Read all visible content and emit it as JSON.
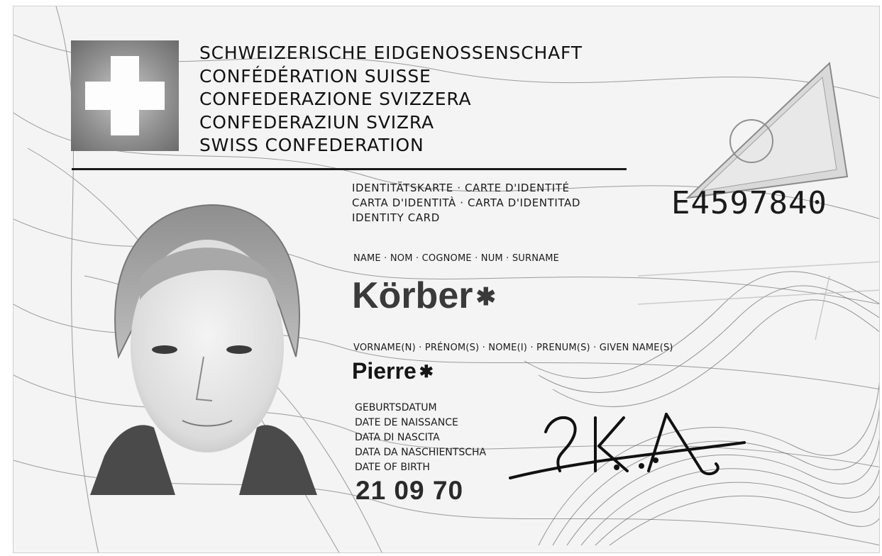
{
  "card": {
    "confederation_lines": [
      "SCHWEIZERISCHE EIDGENOSSENSCHAFT",
      "CONFÉDÉRATION SUISSE",
      "CONFEDERAZIONE SVIZZERA",
      "CONFEDERAZIUN SVIZRA",
      "SWISS CONFEDERATION"
    ],
    "document_type_lines": [
      "IDENTITÄTSKARTE · CARTE D'IDENTITÉ",
      "CARTA D'IDENTITÀ · CARTA D'IDENTITAD",
      "IDENTITY CARD"
    ],
    "document_number": "E4597840",
    "surname_label": "NAME · NOM · COGNOME · NUM · SURNAME",
    "surname": "Körber",
    "given_names_label": "VORNAME(N) · PRÉNOM(S) · NOME(I) · PRENUM(S) · GIVEN NAME(S)",
    "given_names": "Pierre",
    "filler_mark": "✱",
    "dob_labels": [
      "GEBURTSDATUM",
      "DATE DE NAISSANCE",
      "DATA DI NASCITA",
      "DATA DA NASCHIENTSCHA",
      "DATE OF BIRTH"
    ],
    "date_of_birth": "21 09 70"
  },
  "colors": {
    "ink": "#151515",
    "background": "#f4f4f4",
    "flag_gray": "#8e8e8e"
  }
}
